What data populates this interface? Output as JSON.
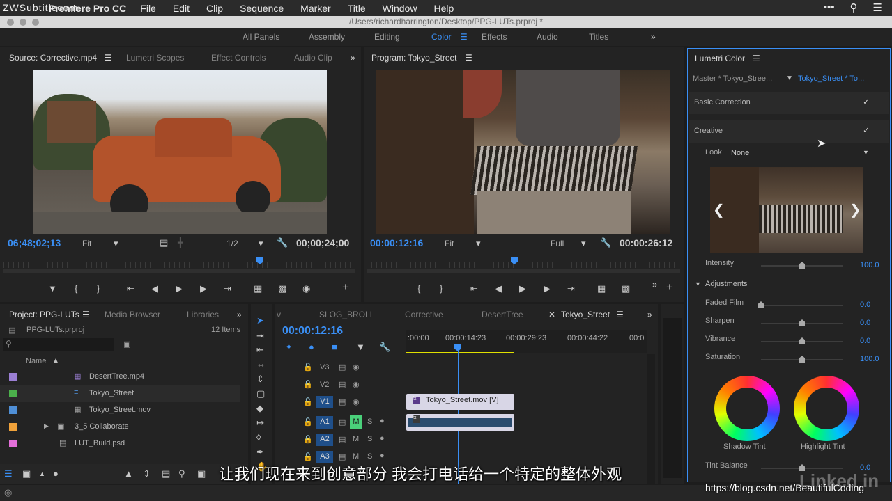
{
  "menubar": {
    "watermark": "ZWSubtitlecom",
    "app_name": "Premiere Pro CC",
    "items": [
      "File",
      "Edit",
      "Clip",
      "Sequence",
      "Marker",
      "Title",
      "Window",
      "Help"
    ]
  },
  "titlebar": {
    "path": "/Users/richardharrington/Desktop/PPG-LUTs.prproj *"
  },
  "workspaces": {
    "items": [
      "All Panels",
      "Assembly",
      "Editing",
      "Color",
      "Effects",
      "Audio",
      "Titles"
    ],
    "active": "Color",
    "more": "»"
  },
  "source": {
    "tabs": [
      "Source: Corrective.mp4",
      "Lumetri Scopes",
      "Effect Controls",
      "Audio Clip"
    ],
    "timecode": "06;48;02;13",
    "fit": "Fit",
    "resolution": "1/2",
    "duration": "00;00;24;00"
  },
  "program": {
    "title": "Program: Tokyo_Street",
    "timecode": "00:00:12:16",
    "fit": "Fit",
    "resolution": "Full",
    "duration": "00:00:26:12"
  },
  "lumetri": {
    "title": "Lumetri Color",
    "master": "Master * Tokyo_Stree...",
    "clip": "Tokyo_Street * To...",
    "basic_correction": "Basic Correction",
    "creative": "Creative",
    "look_label": "Look",
    "look_value": "None",
    "intensity_label": "Intensity",
    "intensity_value": "100.0",
    "adjustments_label": "Adjustments",
    "faded_film_label": "Faded Film",
    "faded_film_value": "0.0",
    "sharpen_label": "Sharpen",
    "sharpen_value": "0.0",
    "vibrance_label": "Vibrance",
    "vibrance_value": "0.0",
    "saturation_label": "Saturation",
    "saturation_value": "100.0",
    "shadow_tint": "Shadow Tint",
    "highlight_tint": "Highlight Tint",
    "tint_balance_label": "Tint Balance",
    "tint_balance_value": "0.0"
  },
  "project": {
    "tabs": [
      "Project: PPG-LUTs",
      "Media Browser",
      "Libraries"
    ],
    "file": "PPG-LUTs.prproj",
    "count": "12 Items",
    "column_name": "Name",
    "items": [
      {
        "label": "DesertTree.mp4",
        "color": "#9b7fd4"
      },
      {
        "label": "Tokyo_Street",
        "color": "#4bb04b"
      },
      {
        "label": "Tokyo_Street.mov",
        "color": "#4f8fd6"
      },
      {
        "label": "3_5 Collaborate",
        "color": "#f0a23a"
      },
      {
        "label": "LUT_Build.psd",
        "color": "#e36fd9"
      }
    ]
  },
  "timeline": {
    "tabs": [
      "v",
      "SLOG_BROLL",
      "Corrective",
      "DesertTree",
      "Tokyo_Street"
    ],
    "active_tab": "Tokyo_Street",
    "timecode": "00:00:12:16",
    "ruler": [
      ":00:00",
      "00:00:14:23",
      "00:00:29:23",
      "00:00:44:22",
      "00:0"
    ],
    "tracks": [
      {
        "label": "V3",
        "type": "video"
      },
      {
        "label": "V2",
        "type": "video"
      },
      {
        "label": "V1",
        "type": "video"
      },
      {
        "label": "A1",
        "type": "audio"
      },
      {
        "label": "A2",
        "type": "audio"
      },
      {
        "label": "A3",
        "type": "audio"
      }
    ],
    "video_clip": "Tokyo_Street.mov [V]",
    "mute_label": "M",
    "solo_label": "S"
  },
  "subtitle": "让我们现在来到创意部分  我会打电话给一个特定的整体外观",
  "watermarks": {
    "csdn": "https://blog.csdn.net/BeautifulCoding",
    "linkedin": "Linked in"
  },
  "colors": {
    "accent_blue": "#3a8ff5",
    "panel_bg": "#232323",
    "border": "#111111",
    "playhead": "#3a8ff5"
  }
}
